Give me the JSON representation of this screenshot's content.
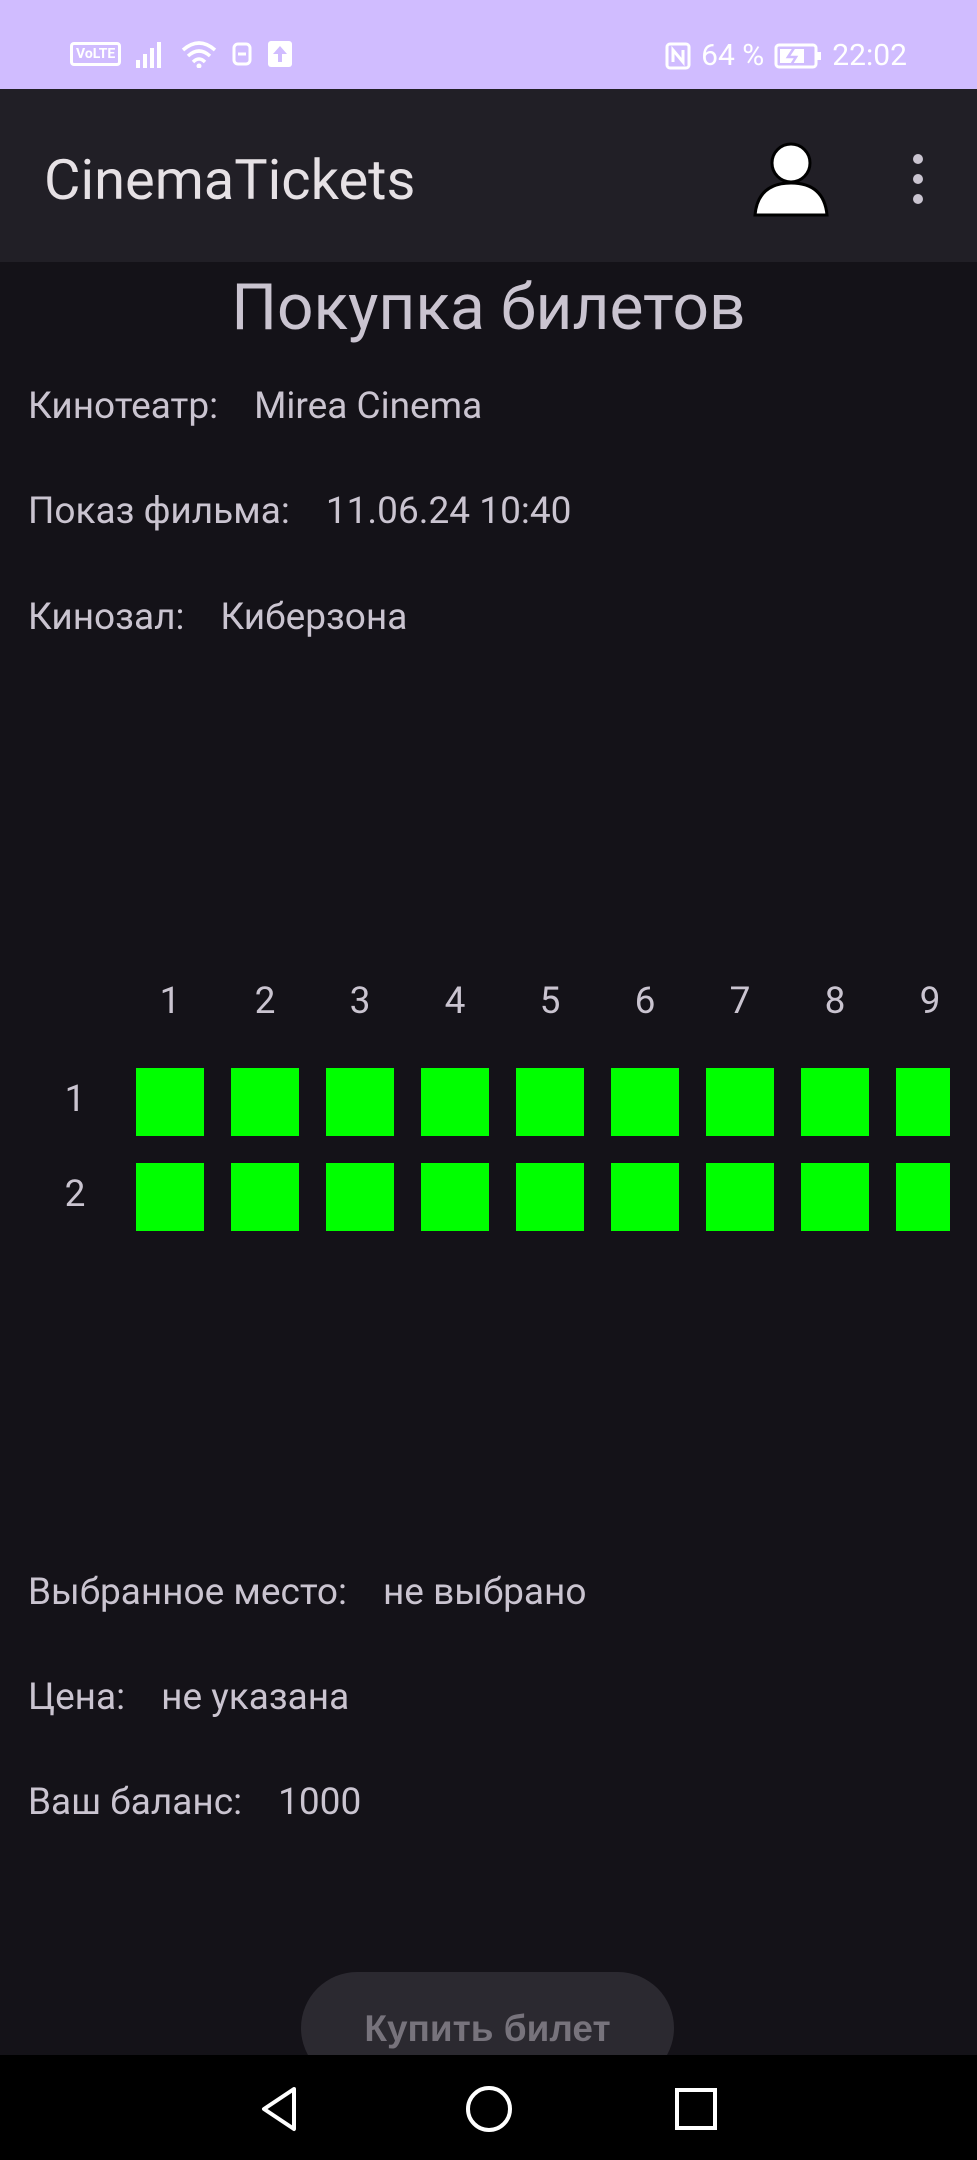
{
  "status_bar": {
    "volte": "VoLTE",
    "battery_percent": "64 %",
    "time": "22:02"
  },
  "app_bar": {
    "title": "CinemaTickets",
    "icons": [
      "account-icon",
      "more-vert-icon"
    ]
  },
  "page": {
    "title": "Покупка билетов",
    "cinema_label": "Кинотеатр:",
    "cinema_value": "Mirea Cinema",
    "show_label": "Показ фильма:",
    "show_value": "11.06.24 10:40",
    "hall_label": "Кинозал:",
    "hall_value": "Киберзона"
  },
  "seats": {
    "columns": [
      "1",
      "2",
      "3",
      "4",
      "5",
      "6",
      "7",
      "8",
      "9"
    ],
    "rows": [
      "1",
      "2"
    ],
    "available_color": "#00ff00"
  },
  "summary": {
    "selected_label": "Выбранное место:",
    "selected_value": "не выбрано",
    "price_label": "Цена:",
    "price_value": "не указана",
    "balance_label": "Ваш баланс:",
    "balance_value": "1000"
  },
  "buy_button": {
    "label": "Купить билет"
  },
  "nav_bar": {
    "icons": [
      "back-icon",
      "home-icon",
      "recents-icon"
    ]
  }
}
